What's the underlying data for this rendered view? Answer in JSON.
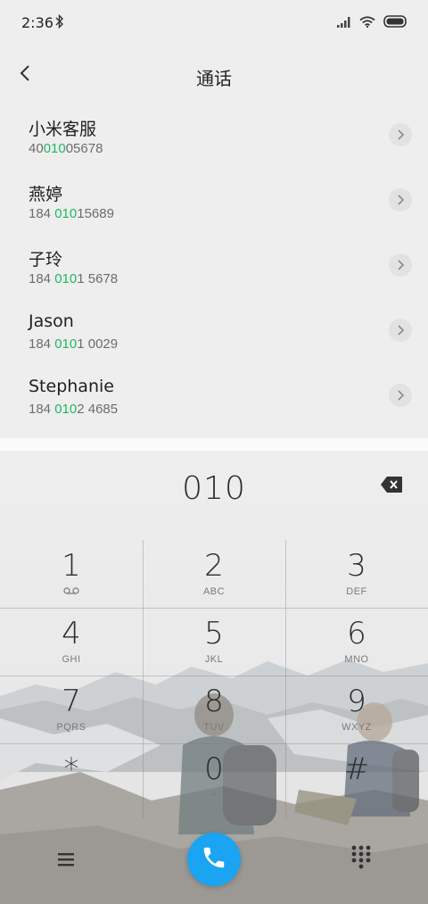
{
  "status": {
    "time": "2:36"
  },
  "header": {
    "title": "通话"
  },
  "results": [
    {
      "name": "小米客服",
      "num_pre": "40",
      "num_hl": "010",
      "num_post": "05678"
    },
    {
      "name": "燕婷",
      "num_pre": "184 ",
      "num_hl": "010",
      "num_post": "15689"
    },
    {
      "name": "子玲",
      "num_pre": "184 ",
      "num_hl": "010",
      "num_post": "1 5678"
    },
    {
      "name": "Jason",
      "num_pre": "184 ",
      "num_hl": "010",
      "num_post": "1 0029"
    },
    {
      "name": "Stephanie",
      "num_pre": "184 ",
      "num_hl": "010",
      "num_post": "2 4685"
    }
  ],
  "dialer": {
    "input": "010",
    "keys": [
      {
        "digit": "1",
        "letters": ""
      },
      {
        "digit": "2",
        "letters": "ABC"
      },
      {
        "digit": "3",
        "letters": "DEF"
      },
      {
        "digit": "4",
        "letters": "GHI"
      },
      {
        "digit": "5",
        "letters": "JKL"
      },
      {
        "digit": "6",
        "letters": "MNO"
      },
      {
        "digit": "7",
        "letters": "PQRS"
      },
      {
        "digit": "8",
        "letters": "TUV"
      },
      {
        "digit": "9",
        "letters": "WXYZ"
      },
      {
        "digit": "*",
        "letters": ""
      },
      {
        "digit": "0",
        "letters": "+"
      },
      {
        "digit": "#",
        "letters": ""
      }
    ]
  },
  "colors": {
    "highlight": "#20b765",
    "call_button": "#1aa4f2"
  },
  "icons": [
    "bluetooth-icon",
    "signal-icon",
    "wifi-icon",
    "battery-icon",
    "back-arrow-icon",
    "chevron-right-icon",
    "backspace-icon",
    "voicemail-icon",
    "menu-icon",
    "phone-icon",
    "dialpad-icon"
  ]
}
